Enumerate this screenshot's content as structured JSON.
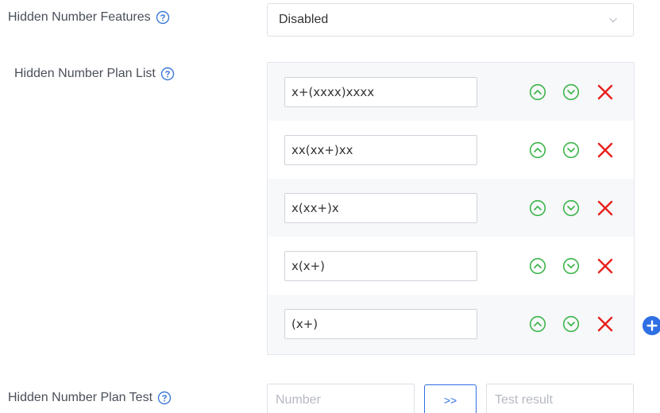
{
  "features": {
    "label": "Hidden Number Features",
    "value": "Disabled"
  },
  "plan_list": {
    "label": "Hidden Number Plan List",
    "items": [
      "x+(xxxx)xxxx",
      "xx(xx+)xx",
      "x(xx+)x",
      "x(x+)",
      "(x+)"
    ]
  },
  "plan_test": {
    "label": "Hidden Number Plan Test",
    "number_placeholder": "Number",
    "button_label": ">>",
    "result_placeholder": "Test result"
  },
  "colors": {
    "accent": "#2f6fe4",
    "move_green": "#3cb54a",
    "delete_red": "#e8201c",
    "help_blue": "#3a78d6"
  },
  "icons": {
    "help": "help-icon",
    "move_up": "move-up-icon",
    "move_down": "move-down-icon",
    "delete": "delete-icon",
    "add": "add-icon",
    "dropdown": "chevron-down-icon"
  }
}
